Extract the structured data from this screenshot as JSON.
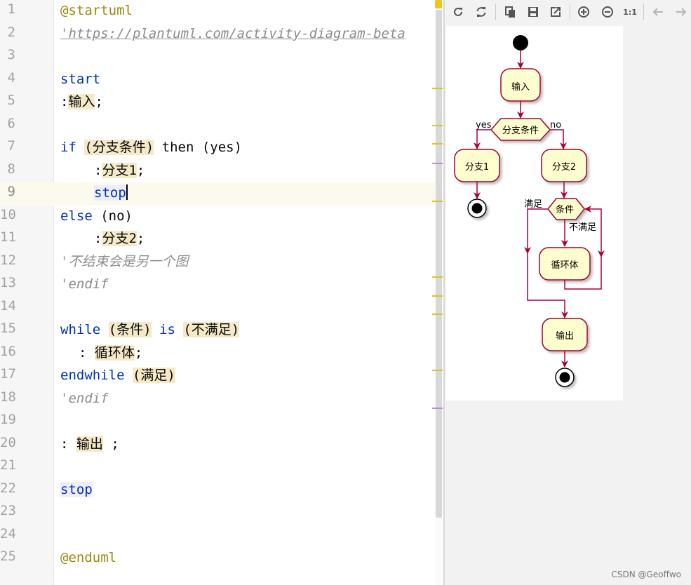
{
  "editor": {
    "line_numbers": [
      "1",
      "2",
      "3",
      "4",
      "5",
      "6",
      "7",
      "8",
      "9",
      "10",
      "11",
      "12",
      "13",
      "14",
      "15",
      "16",
      "17",
      "18",
      "19",
      "20",
      "21",
      "22",
      "23",
      "24",
      "25"
    ],
    "code": {
      "l1": "@startuml",
      "l2": "'https://plantuml.com/activity-diagram-beta",
      "l4": "start",
      "l5_colon": ":",
      "l5_text": "输入",
      "l5_end": ";",
      "l7_if": "if",
      "l7_cond": "(分支条件)",
      "l7_then": " then (yes)",
      "l8_colon": ":",
      "l8_text": "分支1",
      "l8_end": ";",
      "l9": "stop",
      "l10_else": "else",
      "l10_rest": " (no)",
      "l11_colon": ":",
      "l11_text": "分支2",
      "l11_end": ";",
      "l12": "'不结束会是另一个图",
      "l13": "'endif",
      "l15_while": "while",
      "l15_cond": "(条件)",
      "l15_is": "is",
      "l15_val": "(不满足)",
      "l16_colon": ": ",
      "l16_text": "循环体",
      "l16_end": ";",
      "l17_kw": "endwhile",
      "l17_val": "(满足)",
      "l18": "'endif",
      "l20_colon": ": ",
      "l20_text": "输出",
      "l20_end": " ;",
      "l22": "stop",
      "l25": "@enduml"
    }
  },
  "toolbar": {
    "buttons": [
      "refresh-icon",
      "reload-icon",
      "copy-icon",
      "save-icon",
      "export-icon",
      "zoom-in-icon",
      "zoom-out-icon",
      "actual-size",
      "back-arrow-icon",
      "forward-arrow-icon"
    ],
    "actual_size_label": "1:1"
  },
  "diagram": {
    "input_label": "输入",
    "branch_condition": "分支条件",
    "yes_label": "yes",
    "no_label": "no",
    "branch1_label": "分支1",
    "branch2_label": "分支2",
    "loop_condition": "条件",
    "satisfied_label": "满足",
    "not_satisfied_label": "不满足",
    "loop_body_label": "循环体",
    "output_label": "输出",
    "colors": {
      "node_fill": "#fefece",
      "node_stroke": "#a80036",
      "arrow": "#a80036"
    }
  },
  "watermark": "CSDN @Geoffwo"
}
